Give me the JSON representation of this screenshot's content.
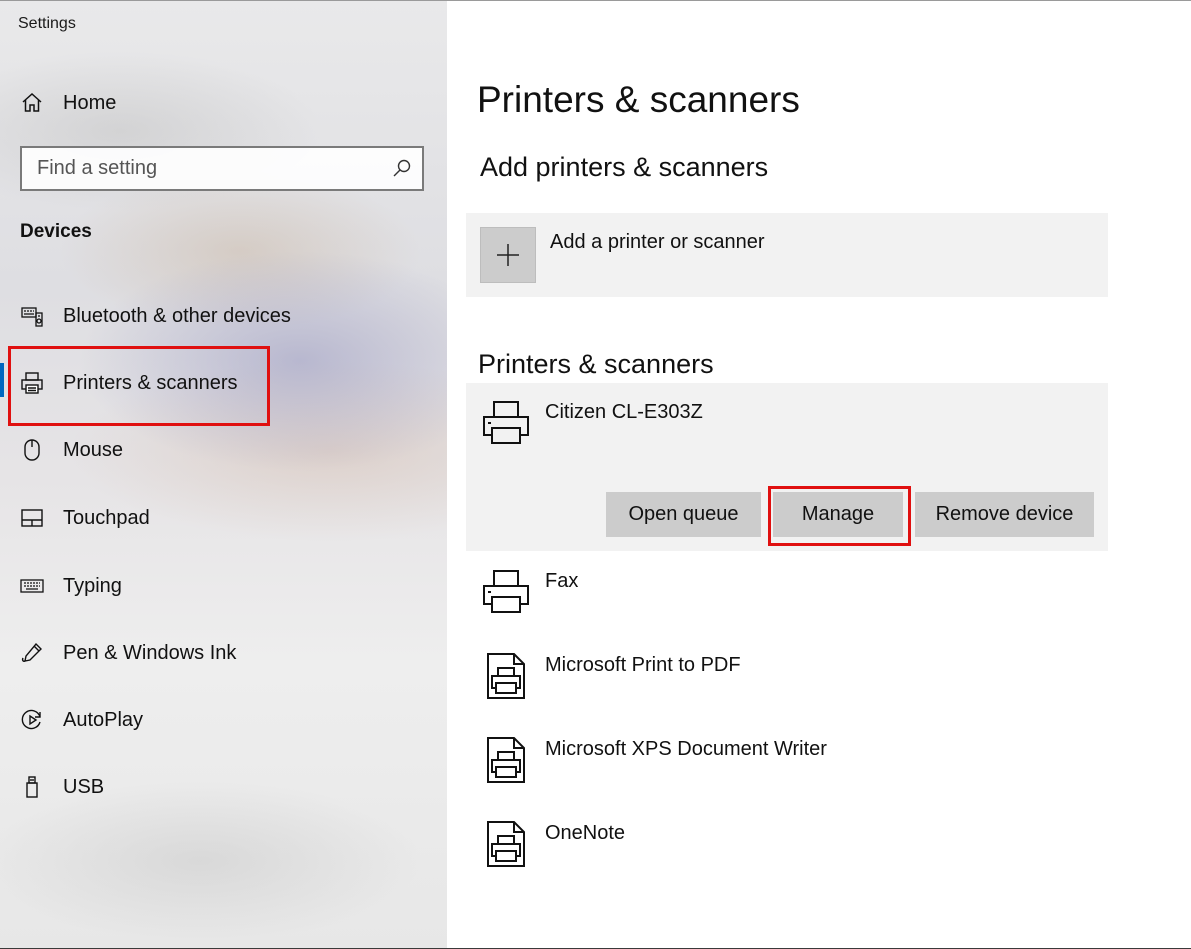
{
  "window": {
    "title": "Settings"
  },
  "sidebar": {
    "home_label": "Home",
    "search": {
      "placeholder": "Find a setting",
      "value": ""
    },
    "section_label": "Devices",
    "items": [
      {
        "label": "Bluetooth & other devices",
        "icon": "bluetooth-devices-icon"
      },
      {
        "label": "Printers & scanners",
        "icon": "printer-icon",
        "selected": true
      },
      {
        "label": "Mouse",
        "icon": "mouse-icon"
      },
      {
        "label": "Touchpad",
        "icon": "touchpad-icon"
      },
      {
        "label": "Typing",
        "icon": "keyboard-icon"
      },
      {
        "label": "Pen & Windows Ink",
        "icon": "pen-icon"
      },
      {
        "label": "AutoPlay",
        "icon": "autoplay-icon"
      },
      {
        "label": "USB",
        "icon": "usb-icon"
      }
    ]
  },
  "main": {
    "page_title": "Printers & scanners",
    "add_section_title": "Add printers & scanners",
    "add_label": "Add a printer or scanner",
    "list_section_title": "Printers & scanners",
    "devices": [
      {
        "name": "Citizen CL-E303Z",
        "icon": "printer-icon",
        "selected": true
      },
      {
        "name": "Fax",
        "icon": "printer-icon"
      },
      {
        "name": "Microsoft Print to PDF",
        "icon": "document-printer-icon"
      },
      {
        "name": "Microsoft XPS Document Writer",
        "icon": "document-printer-icon"
      },
      {
        "name": "OneNote",
        "icon": "document-printer-icon"
      }
    ],
    "actions": {
      "open_queue": "Open queue",
      "manage": "Manage",
      "remove_device": "Remove device"
    }
  },
  "colors": {
    "accent": "#0067c0",
    "highlight": "#e01010",
    "button_bg": "#cccccc",
    "panel_bg": "#f2f2f2"
  }
}
